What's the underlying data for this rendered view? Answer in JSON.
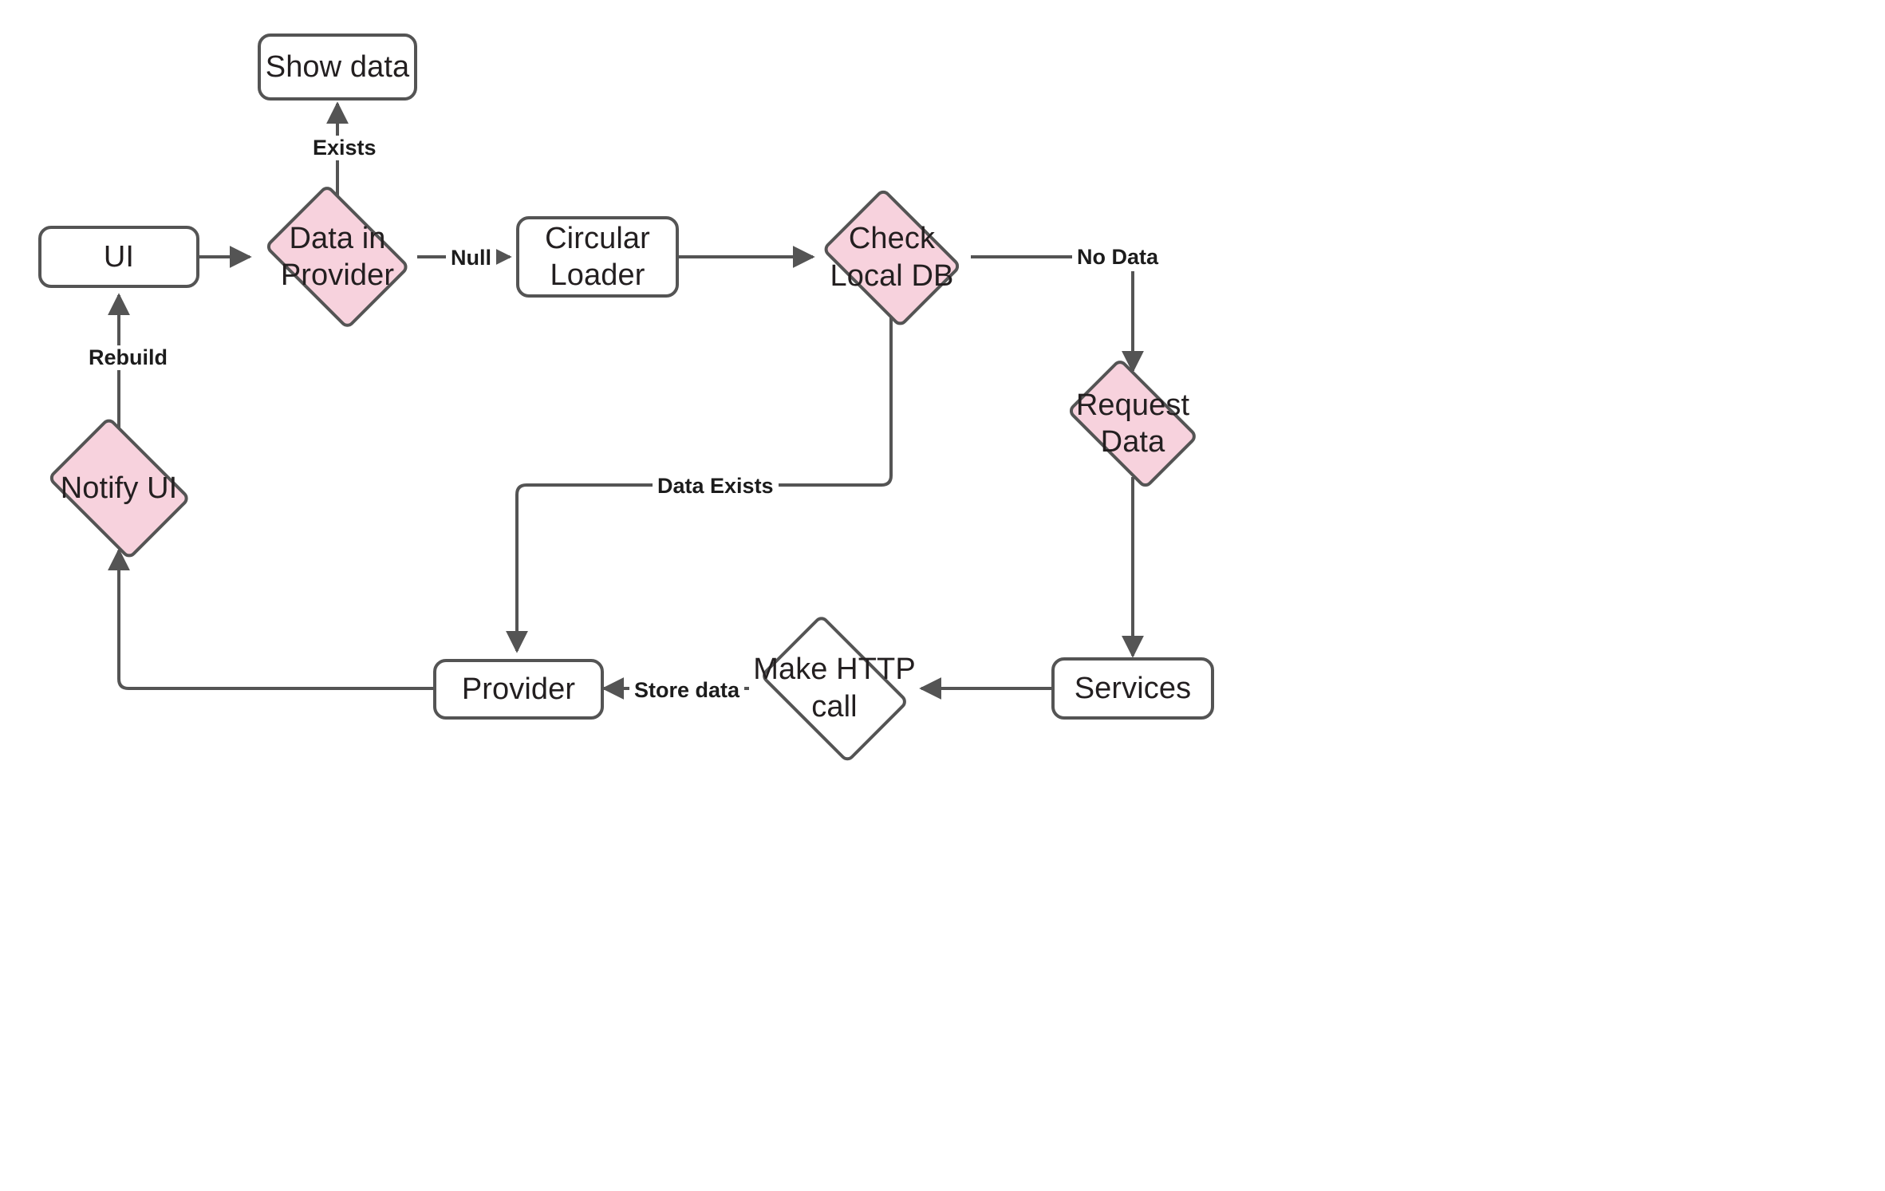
{
  "diagram": {
    "title": "Flutter data flow flowchart",
    "background_color": "#ffffff",
    "stroke_color": "#545454",
    "text_color": "#231f20",
    "accent_fill": "#f7d2dd",
    "plain_fill": "#ffffff"
  },
  "nodes": {
    "show_data": {
      "label": "Show data",
      "shape": "rounded-rect",
      "fill": "#ffffff"
    },
    "ui": {
      "label": "UI",
      "shape": "rounded-rect",
      "fill": "#ffffff"
    },
    "data_in_provider": {
      "label": "Data in\nProvider",
      "shape": "diamond",
      "fill": "#f7d2dd"
    },
    "circular_loader": {
      "label": "Circular\nLoader",
      "shape": "rounded-rect",
      "fill": "#ffffff"
    },
    "check_local_db": {
      "label": "Check\nLocal DB",
      "shape": "diamond",
      "fill": "#f7d2dd"
    },
    "request_data": {
      "label": "Request\nData",
      "shape": "diamond",
      "fill": "#f7d2dd"
    },
    "services": {
      "label": "Services",
      "shape": "rounded-rect",
      "fill": "#ffffff"
    },
    "make_http_call": {
      "label": "Make HTTP\ncall",
      "shape": "diamond",
      "fill": "#ffffff"
    },
    "provider": {
      "label": "Provider",
      "shape": "rounded-rect",
      "fill": "#ffffff"
    },
    "notify_ui": {
      "label": "Notify UI",
      "shape": "diamond",
      "fill": "#f7d2dd"
    }
  },
  "edge_labels": {
    "exists": "Exists",
    "null": "Null",
    "no_data": "No Data",
    "data_exists": "Data Exists",
    "rebuild": "Rebuild",
    "store_data": "Store data"
  },
  "edges": [
    {
      "from": "ui",
      "to": "data_in_provider",
      "label": ""
    },
    {
      "from": "data_in_provider",
      "to": "show_data",
      "label": "Exists"
    },
    {
      "from": "data_in_provider",
      "to": "circular_loader",
      "label": "Null"
    },
    {
      "from": "circular_loader",
      "to": "check_local_db",
      "label": ""
    },
    {
      "from": "check_local_db",
      "to": "request_data",
      "label": "No Data"
    },
    {
      "from": "check_local_db",
      "to": "provider",
      "label": "Data Exists"
    },
    {
      "from": "request_data",
      "to": "services",
      "label": ""
    },
    {
      "from": "services",
      "to": "make_http_call",
      "label": ""
    },
    {
      "from": "make_http_call",
      "to": "provider",
      "label": "Store data"
    },
    {
      "from": "provider",
      "to": "notify_ui",
      "label": ""
    },
    {
      "from": "notify_ui",
      "to": "ui",
      "label": "Rebuild"
    }
  ]
}
